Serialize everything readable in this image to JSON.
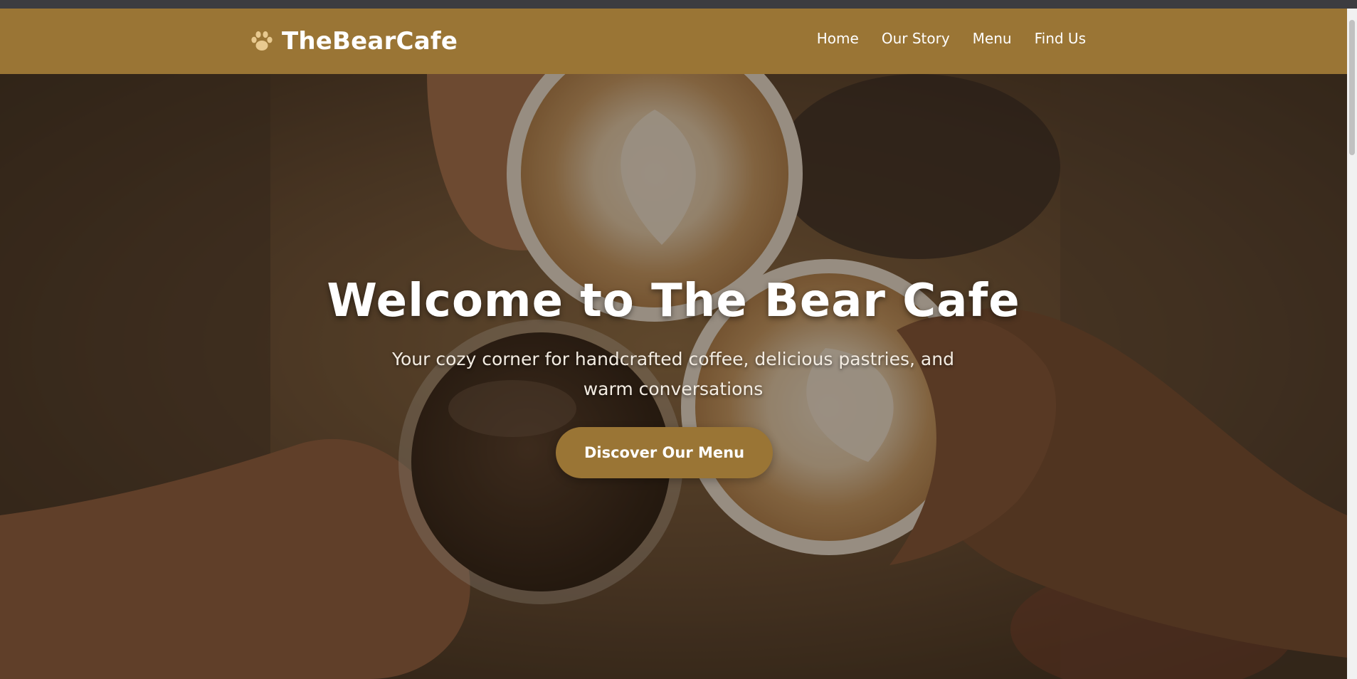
{
  "brand": {
    "name": "TheBearCafe",
    "icon": "paw-icon"
  },
  "nav": {
    "links": [
      "Home",
      "Our Story",
      "Menu",
      "Find Us"
    ]
  },
  "hero": {
    "title": "Welcome to The Bear Cafe",
    "subtitle": "Your cozy corner for handcrafted coffee, delicious pastries, and warm conversations",
    "cta_label": "Discover Our Menu",
    "background": "coffee-cups-toast-photo"
  },
  "colors": {
    "brand": "#9a7535",
    "paw_accent": "#e8c98f",
    "text_light": "#ffffff"
  }
}
